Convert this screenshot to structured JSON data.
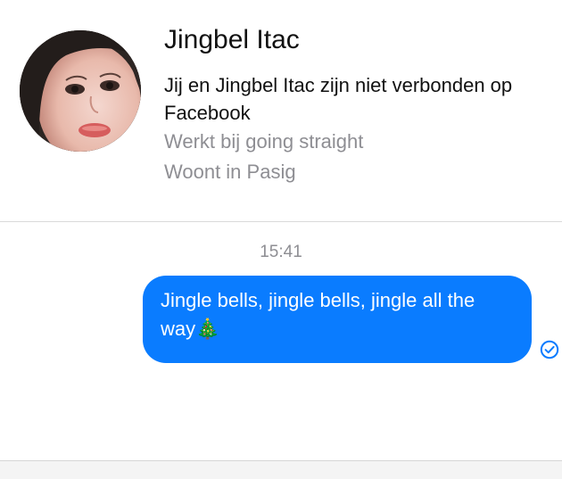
{
  "profile": {
    "name": "Jingbel Itac",
    "connection_status": "Jij en Jingbel Itac zijn niet verbonden op Facebook",
    "work": "Werkt bij going straight",
    "location": "Woont in Pasig"
  },
  "conversation": {
    "timestamp": "15:41",
    "messages": [
      {
        "direction": "outgoing",
        "text": "Jingle bells, jingle bells, jingle all the way🎄",
        "status_icon": "sent-check-icon"
      }
    ]
  },
  "colors": {
    "accent": "#0a7cff",
    "secondary_text": "#8e8e93",
    "divider": "#d9d9d9"
  }
}
